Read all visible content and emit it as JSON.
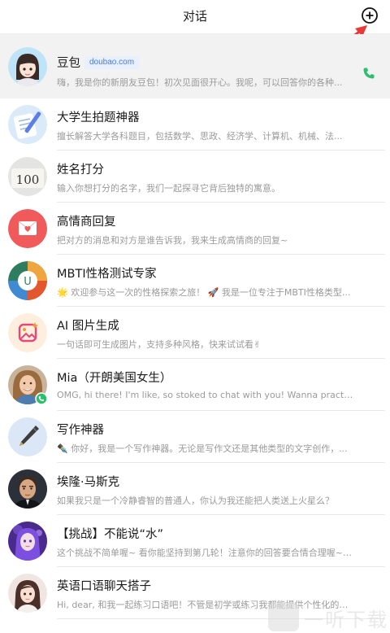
{
  "header": {
    "title": "对话"
  },
  "first": {
    "name": "豆包",
    "badge": "doubao.com",
    "preview": "嗨，我是你的新朋友豆包！初次见面很开心。我呢，可以回答你的各种..."
  },
  "items": [
    {
      "name": "大学生拍题神器",
      "preview": "擅长解答大学各科题目，包括数学、思政、经济学、计算机、机械、法..."
    },
    {
      "name": "姓名打分",
      "preview": "输入你想打分的名字，我们一起探寻它背后独特的寓意。"
    },
    {
      "name": "高情商回复",
      "preview": "把对方的消息和对方是谁告诉我，我来生成高情商的回复~"
    },
    {
      "name": "MBTI性格测试专家",
      "preview": "🌟 欢迎参与这一次的性格探索之旅！ 🚀 我是一位专注于MBTI性格类型..."
    },
    {
      "name": "AI 图片生成",
      "preview": "一句话即可生成图片，支持多种风格，快来试试看✌"
    },
    {
      "name": "Mia（开朗美国女生）",
      "preview": "OMG, hi there! I'm like, so stoked to chat with you! Wanna practice some..."
    },
    {
      "name": "写作神器",
      "preview": "✒️ 你好，我是一个写作神器。无论是写作文还是其他类型的文字创作，..."
    },
    {
      "name": "埃隆·马斯克",
      "preview": "如果我只是一个冷静睿智的普通人，你认为我还能把人类送上火星么？"
    },
    {
      "name": "【挑战】不能说“水”",
      "preview": "这个挑战不简单喔~ 看你能坚持到第几轮！注意你的回答要合情合理喔~ ..."
    },
    {
      "name": "英语口语聊天搭子",
      "preview": "Hi, dear, 和我一起练习口语吧！不管是初学或练习我都能提供个性化的学..."
    }
  ],
  "watermark": {
    "text": "一听下载"
  },
  "colors": {
    "phone": "#2dbf6b",
    "arrow": "#e83a3a",
    "badge_bg": "#e8effd",
    "badge_text": "#4a7be0"
  },
  "icons": {
    "add": "plus-circle-icon",
    "phone": "phone-icon"
  }
}
